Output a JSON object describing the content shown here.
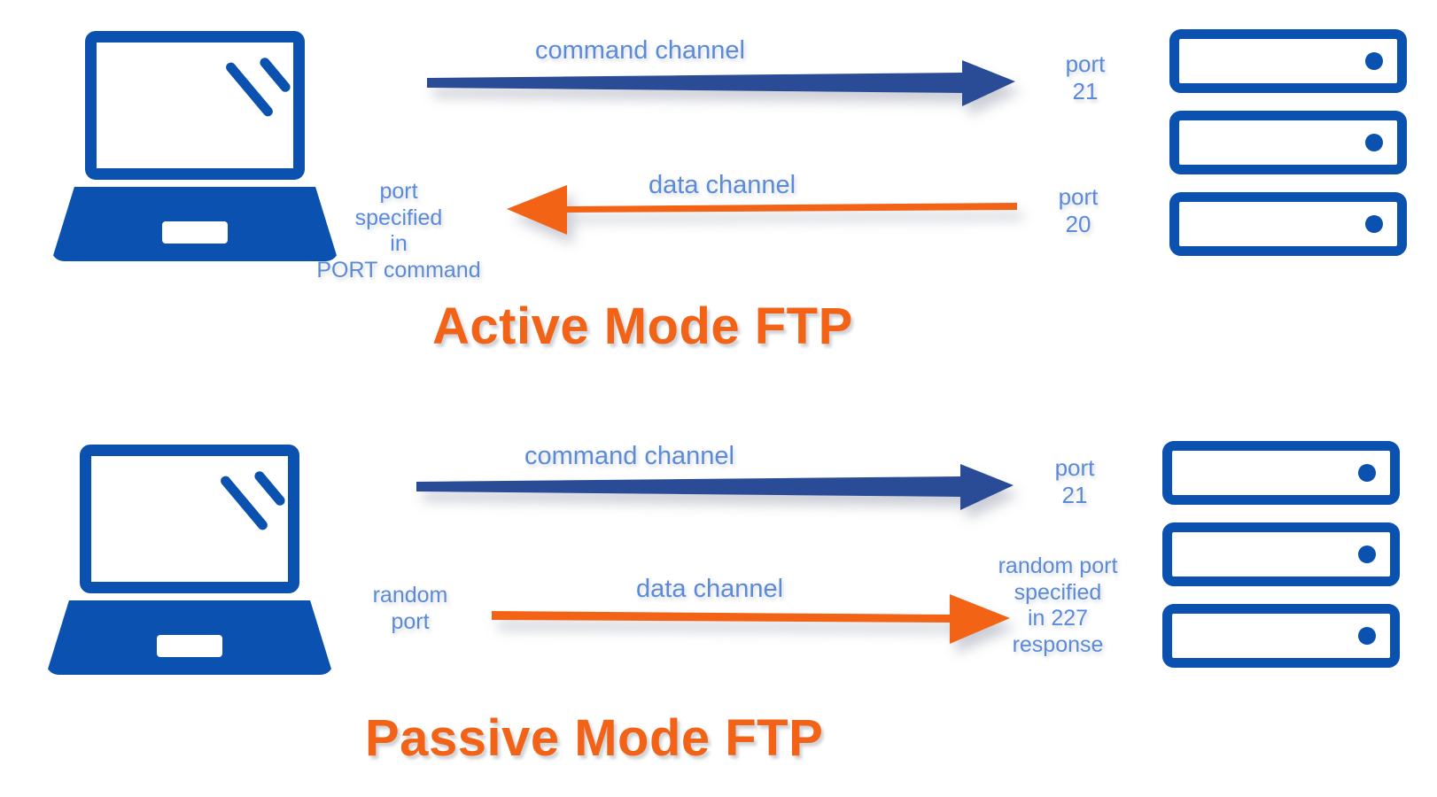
{
  "diagram": {
    "title_active": "Active Mode FTP",
    "title_passive": "Passive Mode FTP",
    "colors": {
      "device_blue": "#0a51b0",
      "command_arrow_blue": "#2b4c96",
      "data_arrow_orange": "#f26318",
      "label_blue": "#5b8ad8",
      "title_orange": "#f26318",
      "background": "#ffffff"
    }
  },
  "active_mode": {
    "client_icon": "laptop-icon",
    "server_icon": "server-stack-icon",
    "command_channel": {
      "caption": "command channel",
      "direction": "client-to-server",
      "color": "#2b4c96",
      "server_port_label": "port\n21"
    },
    "data_channel": {
      "caption": "data channel",
      "direction": "server-to-client",
      "color": "#f26318",
      "client_port_label": "port\nspecified\nin\nPORT command",
      "server_port_label": "port\n20"
    },
    "title": "Active Mode FTP"
  },
  "passive_mode": {
    "client_icon": "laptop-icon",
    "server_icon": "server-stack-icon",
    "command_channel": {
      "caption": "command channel",
      "direction": "client-to-server",
      "color": "#2b4c96",
      "server_port_label": "port\n21"
    },
    "data_channel": {
      "caption": "data channel",
      "direction": "client-to-server",
      "color": "#f26318",
      "client_port_label": "random\nport",
      "server_port_label": "random port\nspecified\nin 227\nresponse"
    },
    "title": "Passive Mode FTP"
  }
}
